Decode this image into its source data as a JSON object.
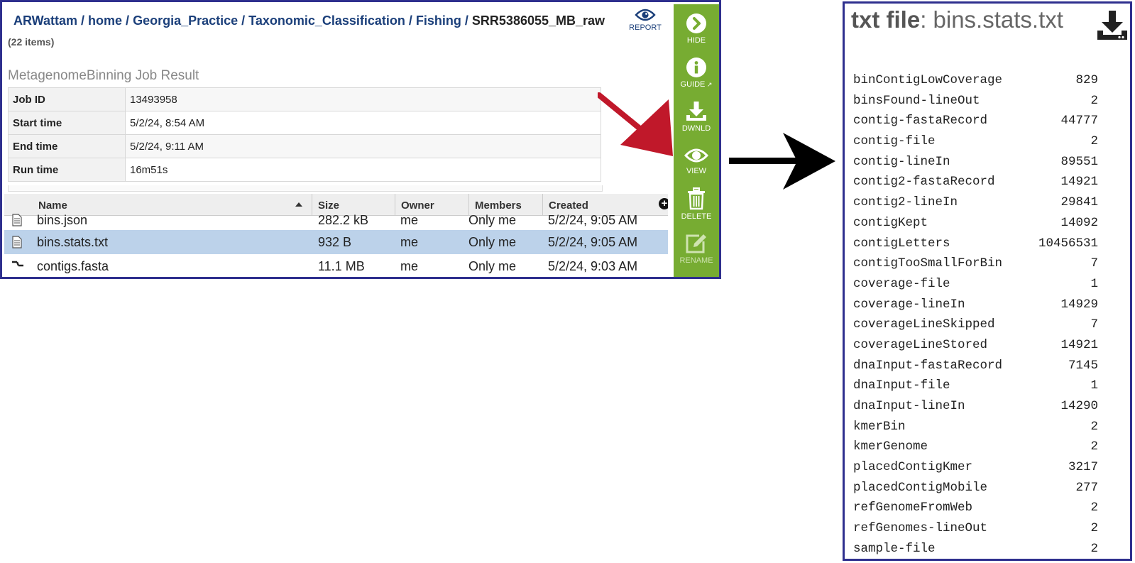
{
  "file_browser": {
    "breadcrumb": [
      "ARWattam",
      "home",
      "Georgia_Practice",
      "Taxonomic_Classification",
      "Fishing"
    ],
    "breadcrumb_current": "SRR5386055_MB_raw",
    "separator": "/",
    "item_count": "(22 items)",
    "report_label": "REPORT",
    "job_title": "MetagenomeBinning Job Result",
    "job_fields": [
      {
        "label": "Job ID",
        "value": "13493958"
      },
      {
        "label": "Start time",
        "value": "5/2/24, 8:54 AM"
      },
      {
        "label": "End time",
        "value": "5/2/24, 9:11 AM"
      },
      {
        "label": "Run time",
        "value": "16m51s"
      }
    ],
    "columns": [
      "Name",
      "Size",
      "Owner",
      "Members",
      "Created"
    ],
    "sort_column": "Name",
    "sort_direction": "ascending",
    "files": [
      {
        "icon": "document-icon",
        "name": "bins.json",
        "size": "282.2 kB",
        "owner": "me",
        "members": "Only me",
        "created": "5/2/24, 9:05 AM",
        "selected": false
      },
      {
        "icon": "document-icon",
        "name": "bins.stats.txt",
        "size": "932 B",
        "owner": "me",
        "members": "Only me",
        "created": "5/2/24, 9:05 AM",
        "selected": true
      },
      {
        "icon": "contigs-icon",
        "name": "contigs.fasta",
        "size": "11.1 MB",
        "owner": "me",
        "members": "Only me",
        "created": "5/2/24, 9:03 AM",
        "selected": false
      }
    ]
  },
  "toolbar": {
    "color": "#77ac32",
    "buttons": [
      {
        "icon": "chevron-right-circle-icon",
        "label": "HIDE"
      },
      {
        "icon": "info-circle-icon",
        "label": "GUIDE"
      },
      {
        "icon": "download-icon",
        "label": "DWNLD"
      },
      {
        "icon": "eye-icon",
        "label": "VIEW"
      },
      {
        "icon": "trash-icon",
        "label": "DELETE"
      },
      {
        "icon": "edit-icon",
        "label": "RENAME"
      }
    ]
  },
  "viewer": {
    "title_bold": "txt file",
    "title_rest": ": bins.stats.txt",
    "download_icon": "download-icon",
    "stats": [
      {
        "key": "binContigLowCoverage",
        "value": "829"
      },
      {
        "key": "binsFound-lineOut",
        "value": "2"
      },
      {
        "key": "contig-fastaRecord",
        "value": "44777"
      },
      {
        "key": "contig-file",
        "value": "2"
      },
      {
        "key": "contig-lineIn",
        "value": "89551"
      },
      {
        "key": "contig2-fastaRecord",
        "value": "14921"
      },
      {
        "key": "contig2-lineIn",
        "value": "29841"
      },
      {
        "key": "contigKept",
        "value": "14092"
      },
      {
        "key": "contigLetters",
        "value": "10456531"
      },
      {
        "key": "contigTooSmallForBin",
        "value": "7"
      },
      {
        "key": "coverage-file",
        "value": "1"
      },
      {
        "key": "coverage-lineIn",
        "value": "14929"
      },
      {
        "key": "coverageLineSkipped",
        "value": "7"
      },
      {
        "key": "coverageLineStored",
        "value": "14921"
      },
      {
        "key": "dnaInput-fastaRecord",
        "value": "7145"
      },
      {
        "key": "dnaInput-file",
        "value": "1"
      },
      {
        "key": "dnaInput-lineIn",
        "value": "14290"
      },
      {
        "key": "kmerBin",
        "value": "2"
      },
      {
        "key": "kmerGenome",
        "value": "2"
      },
      {
        "key": "placedContigKmer",
        "value": "3217"
      },
      {
        "key": "placedContigMobile",
        "value": "277"
      },
      {
        "key": "refGenomeFromWeb",
        "value": "2"
      },
      {
        "key": "refGenomes-lineOut",
        "value": "2"
      },
      {
        "key": "sample-file",
        "value": "2"
      }
    ]
  },
  "annotations": {
    "red_arrow_color": "#c0182a",
    "black_arrow_color": "#000000"
  }
}
